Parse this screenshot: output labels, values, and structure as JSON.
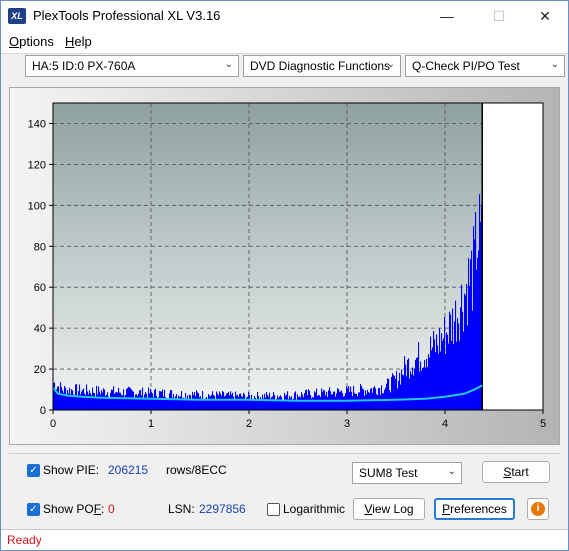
{
  "window": {
    "title": "PlexTools Professional XL V3.16",
    "icon_text": "XL"
  },
  "controls": {
    "minimize": "—",
    "maximize": "☐",
    "close": "✕"
  },
  "menu": [
    {
      "accel": "O",
      "rest": "ptions"
    },
    {
      "accel": "H",
      "rest": "elp"
    }
  ],
  "selectors": {
    "drive": "HA:5 ID:0  PX-760A",
    "function": "DVD Diagnostic Functions",
    "test": "Q-Check PI/PO Test"
  },
  "chart_data": {
    "type": "bar",
    "xlim": [
      0,
      5
    ],
    "ylim": [
      0,
      150
    ],
    "xticks": [
      "0",
      "1",
      "2",
      "3",
      "4",
      "5"
    ],
    "yticks": [
      "0",
      "20",
      "40",
      "60",
      "80",
      "100",
      "120",
      "140"
    ],
    "grid": true,
    "end_marker_x": 4.38,
    "bar_color": "#0000ff",
    "line_color": "#1ec8e6",
    "pie_envelope": {
      "x": [
        0,
        0.1,
        0.5,
        1,
        1.5,
        2,
        2.5,
        3,
        3.2,
        3.4,
        3.5,
        3.6,
        3.7,
        3.8,
        3.9,
        4.0,
        4.1,
        4.2,
        4.25,
        4.3,
        4.32,
        4.35,
        4.38
      ],
      "y": [
        16,
        12,
        11,
        10,
        9,
        8,
        9,
        11,
        12,
        14,
        18,
        26,
        30,
        34,
        38,
        45,
        55,
        70,
        78,
        85,
        105,
        100,
        95
      ]
    },
    "pif_line": {
      "x": [
        0,
        0.05,
        0.15,
        0.3,
        0.5,
        1,
        1.5,
        2,
        2.5,
        3,
        3.5,
        3.8,
        4.0,
        4.2,
        4.3,
        4.38
      ],
      "y": [
        11,
        8,
        7,
        6.5,
        6,
        5.5,
        5,
        5,
        4.5,
        4.5,
        5,
        5.5,
        6.5,
        8,
        10,
        12
      ]
    }
  },
  "panel": {
    "show_pie_label": "Show PIE:",
    "pie_value": "206215",
    "pie_unit": "rows/8ECC",
    "show_pof_label_pre": "Show PO",
    "show_pof_label_accel": "F",
    "show_pof_label_post": ":",
    "pof_value": "0",
    "lsn_label": "LSN:",
    "lsn_value": "2297856",
    "logarithmic_label": "Logarithmic",
    "sum_select": "SUM8 Test",
    "start_accel": "S",
    "start_rest": "tart",
    "viewlog_accel": "V",
    "viewlog_rest": "iew Log",
    "prefs_accel": "P",
    "prefs_rest": "references",
    "info_glyph": "i"
  },
  "status": "Ready"
}
